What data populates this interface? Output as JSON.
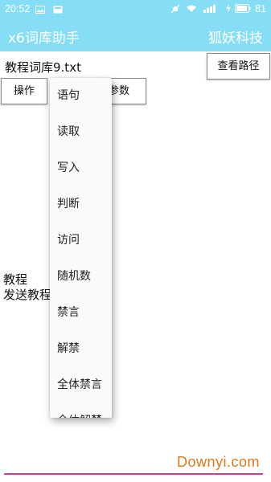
{
  "status_bar": {
    "time": "20:52",
    "battery": "81",
    "icons": [
      "image-icon",
      "mail-icon",
      "mute-icon",
      "wifi-icon",
      "signal-icon",
      "charging-icon",
      "battery-icon"
    ]
  },
  "app_bar": {
    "title": "x6词库助手",
    "company": "狐妖科技"
  },
  "file": {
    "name": "教程词库9.txt",
    "view_path_label": "查看路径"
  },
  "toolbar": {
    "operation_label": "操作",
    "parameter_label": "参数"
  },
  "content": {
    "line1": "教程",
    "line2": "发送教程"
  },
  "menu": {
    "items": [
      "语句",
      "读取",
      "写入",
      "判断",
      "访问",
      "随机数",
      "禁言",
      "解禁",
      "全体禁言",
      "全体解禁"
    ]
  },
  "watermark": "Downyi.com",
  "colors": {
    "app_bar": "#86ddf6",
    "watermark": "#e0781a",
    "bottom_line": "#d23c8a"
  }
}
